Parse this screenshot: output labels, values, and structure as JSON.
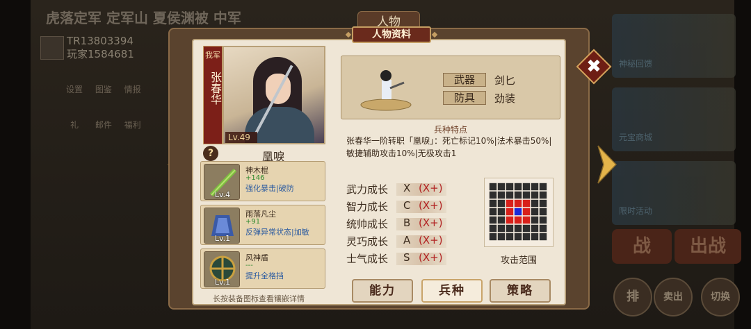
{
  "background": {
    "title": "虎落定军 定军山 夏侯渊被 中军",
    "player_id_1": "TR13803394",
    "player_id_2": "玩家1584681",
    "icons": [
      "设置",
      "图鉴",
      "情报",
      "礼",
      "邮件",
      "福利",
      "排"
    ],
    "card_labels": [
      "神秘回馈",
      "元宝商城",
      "限时活动"
    ],
    "btn_zhan": "战",
    "btn_chuzhan": "出战",
    "round_1": "排",
    "round_2": "卖出",
    "round_3": "切换"
  },
  "panel": {
    "top_tab": "人物",
    "header": "人物资料",
    "close": "✖"
  },
  "character": {
    "tag": "我军",
    "name": "张春华",
    "level": "Lv.49",
    "class": "凰唳",
    "help": "?"
  },
  "equipment": [
    {
      "name": "神木棍",
      "value": "+146",
      "effect": "强化暴击|破防",
      "level": "Lv.4"
    },
    {
      "name": "雨落凡尘",
      "value": "+91",
      "effect": "反弹异常状态|加敏",
      "level": "Lv.1"
    },
    {
      "name": "风神盾",
      "value": "---",
      "effect": "提升全格挡",
      "level": "Lv.1"
    }
  ],
  "hint": "长按装备图标查看镶嵌详情",
  "unit": {
    "weapon_label": "武器",
    "weapon_value": "剑匕",
    "armor_label": "防具",
    "armor_value": "劲装"
  },
  "traits": {
    "title": "兵种特点",
    "text": "张春华一阶转职「凰唳」：死亡标记10%|法术暴击50%|敏捷辅助攻击10%|无极攻击1"
  },
  "growth": [
    {
      "label": "武力成长",
      "grade": "X",
      "bonus": "(X+)"
    },
    {
      "label": "智力成长",
      "grade": "C",
      "bonus": "(X+)"
    },
    {
      "label": "统帅成长",
      "grade": "B",
      "bonus": "(X+)"
    },
    {
      "label": "灵巧成长",
      "grade": "A",
      "bonus": "(X+)"
    },
    {
      "label": "士气成长",
      "grade": "S",
      "bonus": "(X+)"
    }
  ],
  "range": {
    "label": "攻击范围"
  },
  "tabs": [
    "能力",
    "兵种",
    "策略"
  ],
  "colors": {
    "accent": "#6a2a1c",
    "growth_bonus": "#b22222",
    "equip_value": "#2e8a2e",
    "equip_effect": "#2a5aa0"
  }
}
